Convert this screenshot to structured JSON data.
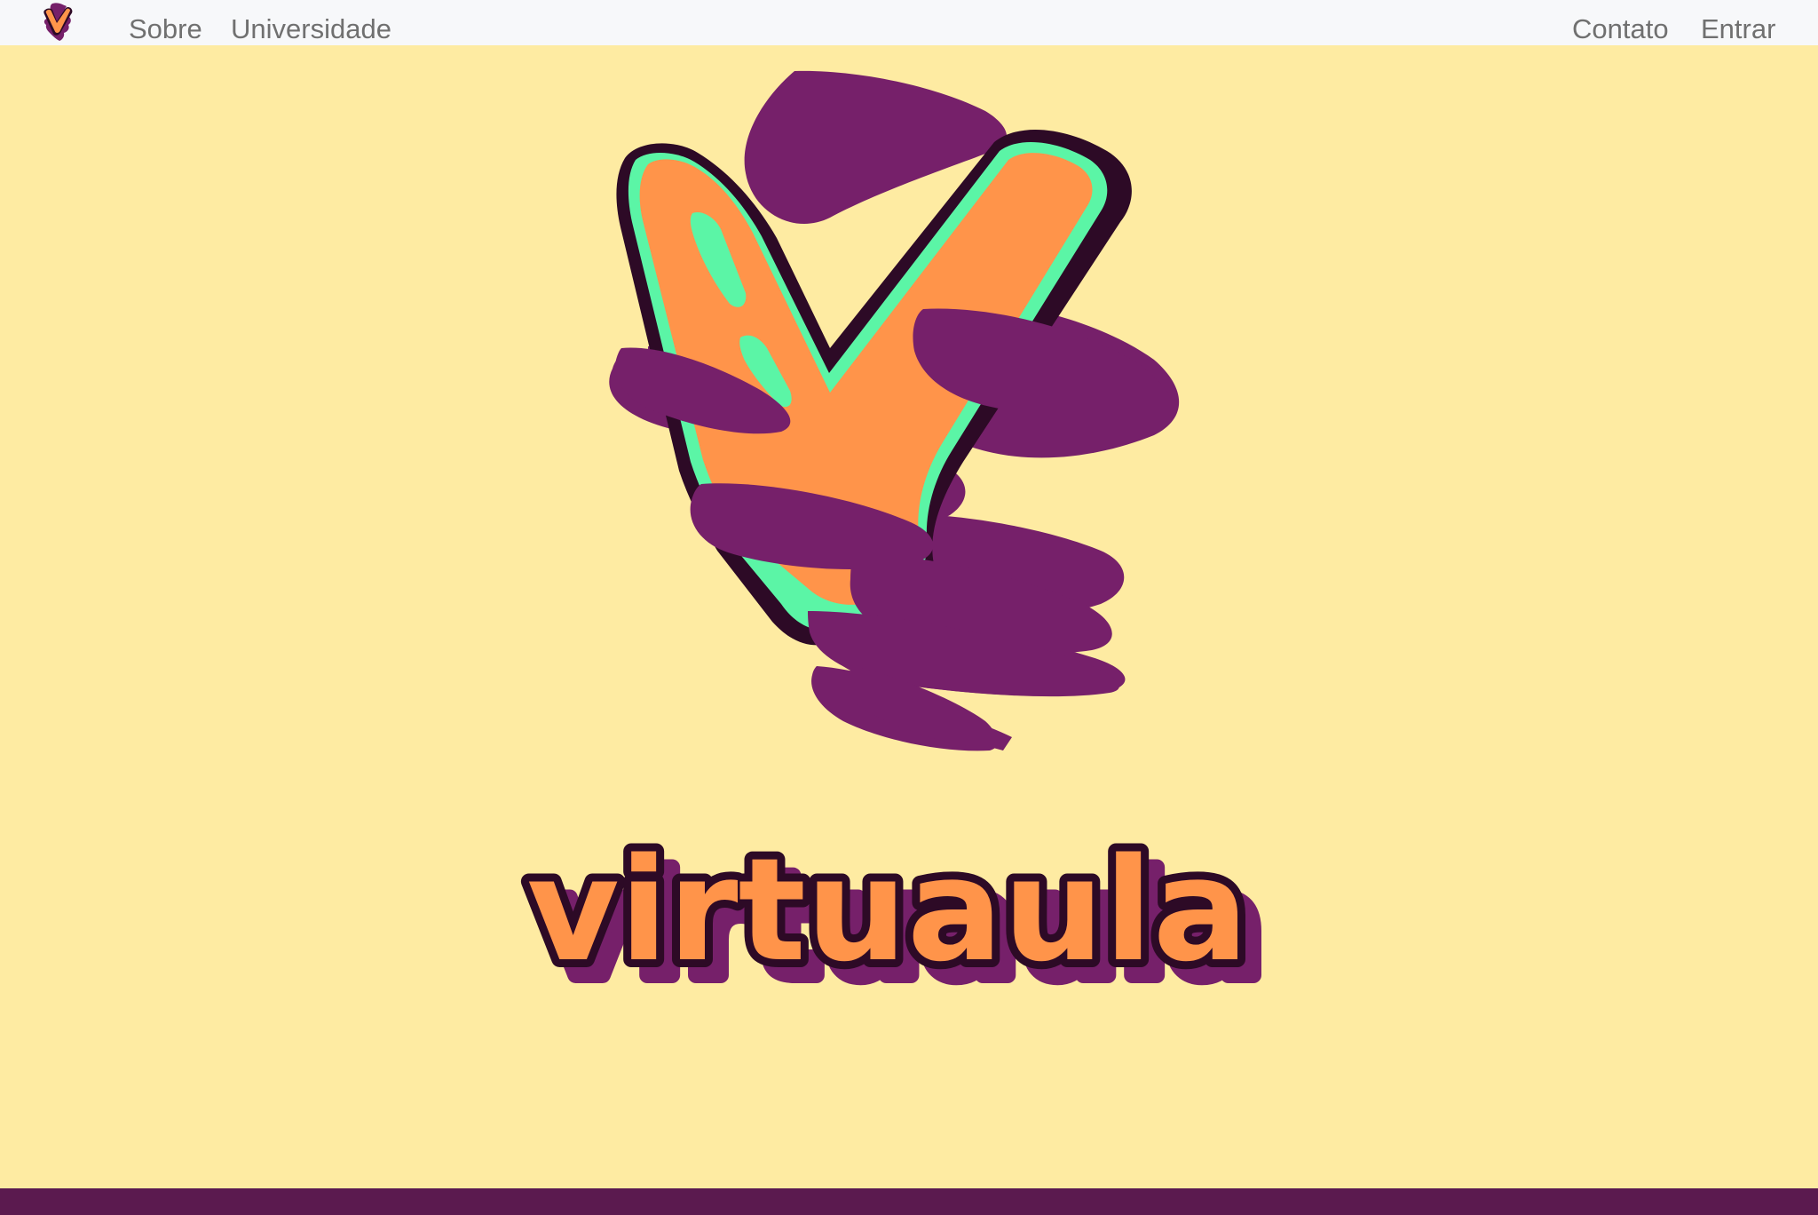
{
  "nav": {
    "brand_name": "virtuaula",
    "left_links": [
      "Sobre",
      "Universidade"
    ],
    "right_links": [
      "Contato",
      "Entrar"
    ]
  },
  "hero": {
    "wordmark": "virtuaula"
  },
  "colors": {
    "page_background": "#FEEBA2",
    "navbar_background": "#F7F8FA",
    "nav_link_text": "#707070",
    "footer_bar": "#5B1A4F",
    "brand_purple": "#76206A",
    "brand_orange": "#FF944A",
    "brand_mint": "#5BF5A6",
    "brand_outline": "#2D0A26"
  }
}
